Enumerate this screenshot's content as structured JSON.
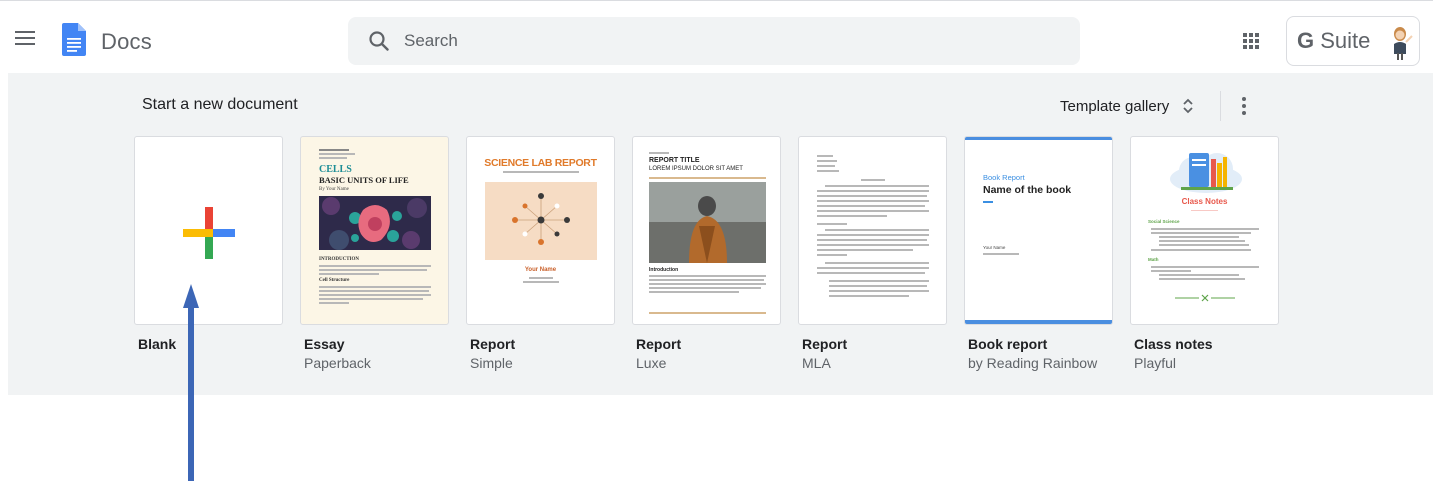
{
  "header": {
    "app_name": "Docs",
    "search_placeholder": "Search",
    "brand_g": "G",
    "brand_rest": " Suite"
  },
  "panel": {
    "title": "Start a new document",
    "gallery_label": "Template gallery"
  },
  "templates": [
    {
      "title": "Blank",
      "subtitle": ""
    },
    {
      "title": "Essay",
      "subtitle": "Paperback"
    },
    {
      "title": "Report",
      "subtitle": "Simple"
    },
    {
      "title": "Report",
      "subtitle": "Luxe"
    },
    {
      "title": "Report",
      "subtitle": "MLA"
    },
    {
      "title": "Book report",
      "subtitle": "by Reading Rainbow"
    },
    {
      "title": "Class notes",
      "subtitle": "Playful"
    }
  ],
  "thumbnails": {
    "essay": {
      "h1": "CELLS",
      "h2": "BASIC UNITS OF LIFE",
      "author": "By Your Name",
      "intro": "INTRODUCTION",
      "section": "Cell Structure"
    },
    "simple": {
      "title": "SCIENCE LAB REPORT",
      "name": "Your Name"
    },
    "luxe": {
      "title": "REPORT TITLE",
      "subtitle": "LOREM IPSUM DOLOR SIT AMET",
      "intro": "Introduction"
    },
    "book": {
      "kicker": "Book Report",
      "name": "Name of the book",
      "your_name": "Your Name"
    },
    "classnotes": {
      "title": "Class Notes",
      "sec1": "Social Science",
      "sec2": "Math"
    }
  },
  "colors": {
    "google_blue": "#4285f4",
    "google_red": "#ea4335",
    "google_yellow": "#fbbc04",
    "google_green": "#34a853",
    "arrow": "#3c66b6",
    "panel_bg": "#f1f3f4"
  }
}
